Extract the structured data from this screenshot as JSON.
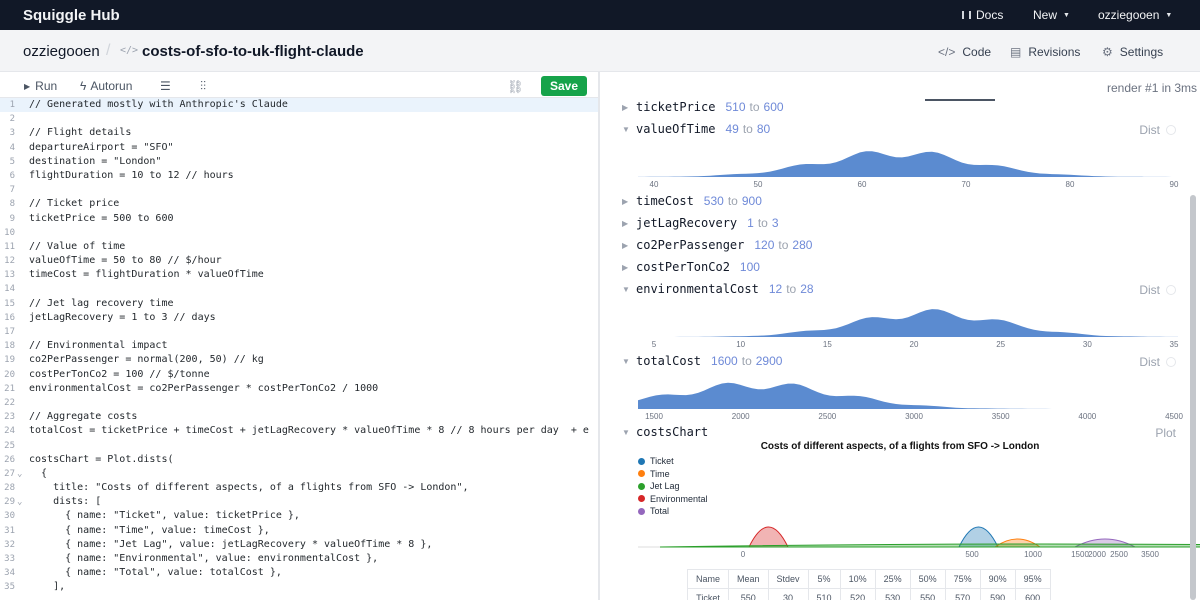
{
  "app": {
    "brand": "Squiggle Hub",
    "nav": {
      "docs": "Docs",
      "new": "New",
      "user": "ozziegooen"
    }
  },
  "header": {
    "owner": "ozziegooen",
    "model": "costs-of-sfo-to-uk-flight-claude",
    "tabs": [
      {
        "label": "Code",
        "active": true
      },
      {
        "label": "Revisions",
        "active": false
      },
      {
        "label": "Settings",
        "active": false
      }
    ]
  },
  "toolbar": {
    "run": "Run",
    "autorun": "Autorun",
    "save": "Save"
  },
  "render_status": "render #1 in 3ms",
  "editor": {
    "lines": [
      {
        "n": "1",
        "text": "// Generated mostly with Anthropic's Claude",
        "active": true
      },
      {
        "n": "2",
        "text": ""
      },
      {
        "n": "3",
        "text": "// Flight details"
      },
      {
        "n": "4",
        "text": "departureAirport = \"SFO\""
      },
      {
        "n": "5",
        "text": "destination = \"London\""
      },
      {
        "n": "6",
        "text": "flightDuration = 10 to 12 // hours"
      },
      {
        "n": "7",
        "text": ""
      },
      {
        "n": "8",
        "text": "// Ticket price"
      },
      {
        "n": "9",
        "text": "ticketPrice = 500 to 600"
      },
      {
        "n": "10",
        "text": ""
      },
      {
        "n": "11",
        "text": "// Value of time"
      },
      {
        "n": "12",
        "text": "valueOfTime = 50 to 80 // $/hour"
      },
      {
        "n": "13",
        "text": "timeCost = flightDuration * valueOfTime"
      },
      {
        "n": "14",
        "text": ""
      },
      {
        "n": "15",
        "text": "// Jet lag recovery time"
      },
      {
        "n": "16",
        "text": "jetLagRecovery = 1 to 3 // days"
      },
      {
        "n": "17",
        "text": ""
      },
      {
        "n": "18",
        "text": "// Environmental impact"
      },
      {
        "n": "19",
        "text": "co2PerPassenger = normal(200, 50) // kg"
      },
      {
        "n": "20",
        "text": "costPerTonCo2 = 100 // $/tonne"
      },
      {
        "n": "21",
        "text": "environmentalCost = co2PerPassenger * costPerTonCo2 / 1000"
      },
      {
        "n": "22",
        "text": ""
      },
      {
        "n": "23",
        "text": "// Aggregate costs"
      },
      {
        "n": "24",
        "text": "totalCost = ticketPrice + timeCost + jetLagRecovery * valueOfTime * 8 // 8 hours per day  + e"
      },
      {
        "n": "25",
        "text": ""
      },
      {
        "n": "26",
        "text": "costsChart = Plot.dists("
      },
      {
        "n": "27",
        "text": "  {",
        "fold": "⌄"
      },
      {
        "n": "28",
        "text": "    title: \"Costs of different aspects, of a flights from SFO -> London\","
      },
      {
        "n": "29",
        "text": "    dists: [",
        "fold": "⌄"
      },
      {
        "n": "30",
        "text": "      { name: \"Ticket\", value: ticketPrice },"
      },
      {
        "n": "31",
        "text": "      { name: \"Time\", value: timeCost },"
      },
      {
        "n": "32",
        "text": "      { name: \"Jet Lag\", value: jetLagRecovery * valueOfTime * 8 },"
      },
      {
        "n": "33",
        "text": "      { name: \"Environmental\", value: environmentalCost },"
      },
      {
        "n": "34",
        "text": "      { name: \"Total\", value: totalCost },"
      },
      {
        "n": "35",
        "text": "    ],"
      }
    ]
  },
  "variables": [
    {
      "name": "ticketPrice",
      "from": "510",
      "to": "600",
      "expanded": false
    },
    {
      "name": "valueOfTime",
      "from": "49",
      "to": "80",
      "expanded": true,
      "tag": "Dist",
      "ticks": [
        "40",
        "50",
        "60",
        "70",
        "80",
        "90"
      ]
    },
    {
      "name": "timeCost",
      "from": "530",
      "to": "900",
      "expanded": false
    },
    {
      "name": "jetLagRecovery",
      "from": "1",
      "to": "3",
      "expanded": false
    },
    {
      "name": "co2PerPassenger",
      "from": "120",
      "to": "280",
      "expanded": false
    },
    {
      "name": "costPerTonCo2",
      "value": "100",
      "expanded": false
    },
    {
      "name": "environmentalCost",
      "from": "12",
      "to": "28",
      "expanded": true,
      "tag": "Dist",
      "ticks": [
        "5",
        "10",
        "15",
        "20",
        "25",
        "30",
        "35"
      ]
    },
    {
      "name": "totalCost",
      "from": "1600",
      "to": "2900",
      "expanded": true,
      "tag": "Dist",
      "ticks": [
        "1500",
        "2000",
        "2500",
        "3000",
        "3500",
        "4000",
        "4500"
      ]
    },
    {
      "name": "costsChart",
      "expanded": true,
      "tag": "Plot"
    }
  ],
  "plot": {
    "title": "Costs of different aspects, of a flights from SFO -> London",
    "legend": [
      {
        "name": "Ticket",
        "color": "#1f77b4"
      },
      {
        "name": "Time",
        "color": "#ff7f0e"
      },
      {
        "name": "Jet Lag",
        "color": "#2ca02c"
      },
      {
        "name": "Environmental",
        "color": "#d62728"
      },
      {
        "name": "Total",
        "color": "#9467bd"
      }
    ],
    "ticks": [
      "0",
      "500",
      "1000",
      "1500",
      "2000",
      "2500",
      "3500"
    ]
  },
  "stats": {
    "headers": [
      "Name",
      "Mean",
      "Stdev",
      "5%",
      "10%",
      "25%",
      "50%",
      "75%",
      "90%",
      "95%"
    ],
    "row": [
      "Ticket",
      "550",
      "30",
      "510",
      "520",
      "530",
      "550",
      "570",
      "590",
      "600"
    ]
  }
}
